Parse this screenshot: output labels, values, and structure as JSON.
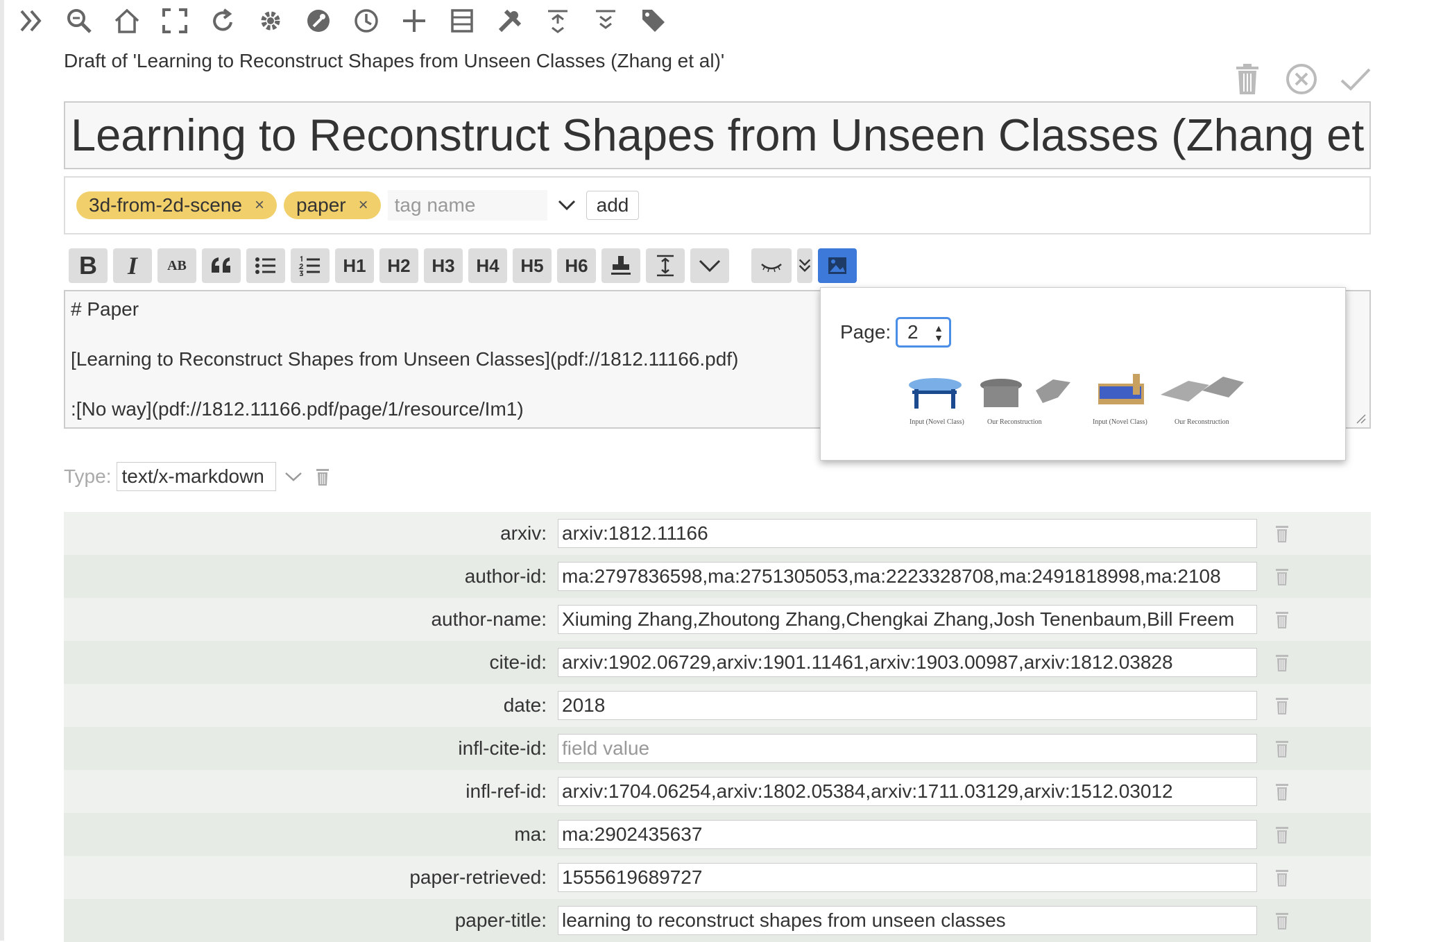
{
  "toolbar": {
    "icons": [
      "chevron-double-right-icon",
      "search-icon",
      "home-icon",
      "fullscreen-icon",
      "refresh-icon",
      "gear-icon",
      "wrench-icon",
      "history-icon",
      "plus-icon",
      "storage-icon",
      "tools-icon",
      "fold-icon",
      "unfold-icon",
      "tag-icon"
    ]
  },
  "draft_title": "Draft of 'Learning to Reconstruct Shapes from Unseen Classes (Zhang et al)'",
  "title": "Learning to Reconstruct Shapes from Unseen Classes (Zhang et al)",
  "tags": {
    "items": [
      {
        "label": "3d-from-2d-scene",
        "remove": "×"
      },
      {
        "label": "paper",
        "remove": "×"
      }
    ],
    "placeholder": "tag name",
    "add_label": "add"
  },
  "format_toolbar": {
    "bold": "B",
    "italic": "I",
    "smallcaps": "AB",
    "h1": "H1",
    "h2": "H2",
    "h3": "H3",
    "h4": "H4",
    "h5": "H5",
    "h6": "H6"
  },
  "editor": {
    "lines": [
      "# Paper",
      "[Learning to Reconstruct Shapes from Unseen Classes](pdf://1812.11166.pdf)",
      ":[No way](pdf://1812.11166.pdf/page/1/resource/Im1)"
    ]
  },
  "popup": {
    "page_label": "Page:",
    "page_value": "2",
    "captions": [
      "Input (Novel Class)",
      "Our Reconstruction",
      "Input (Novel Class)",
      "Our Reconstruction"
    ]
  },
  "type": {
    "label": "Type:",
    "value": "text/x-markdown"
  },
  "fields": [
    {
      "label": "arxiv:",
      "value": "arxiv:1812.11166"
    },
    {
      "label": "author-id:",
      "value": "ma:2797836598,ma:2751305053,ma:2223328708,ma:2491818998,ma:2108"
    },
    {
      "label": "author-name:",
      "value": "Xiuming Zhang,Zhoutong Zhang,Chengkai Zhang,Josh Tenenbaum,Bill Freem"
    },
    {
      "label": "cite-id:",
      "value": "arxiv:1902.06729,arxiv:1901.11461,arxiv:1903.00987,arxiv:1812.03828"
    },
    {
      "label": "date:",
      "value": "2018"
    },
    {
      "label": "infl-cite-id:",
      "value": "",
      "placeholder": "field value"
    },
    {
      "label": "infl-ref-id:",
      "value": "arxiv:1704.06254,arxiv:1802.05384,arxiv:1711.03129,arxiv:1512.03012"
    },
    {
      "label": "ma:",
      "value": "ma:2902435637"
    },
    {
      "label": "paper-retrieved:",
      "value": "1555619689727"
    },
    {
      "label": "paper-title:",
      "value": "learning to reconstruct shapes from unseen classes"
    }
  ],
  "colors": {
    "tag_bg": "#f1cf6a",
    "active_button": "#3c79d9",
    "row_bg": "#eef1ee"
  }
}
